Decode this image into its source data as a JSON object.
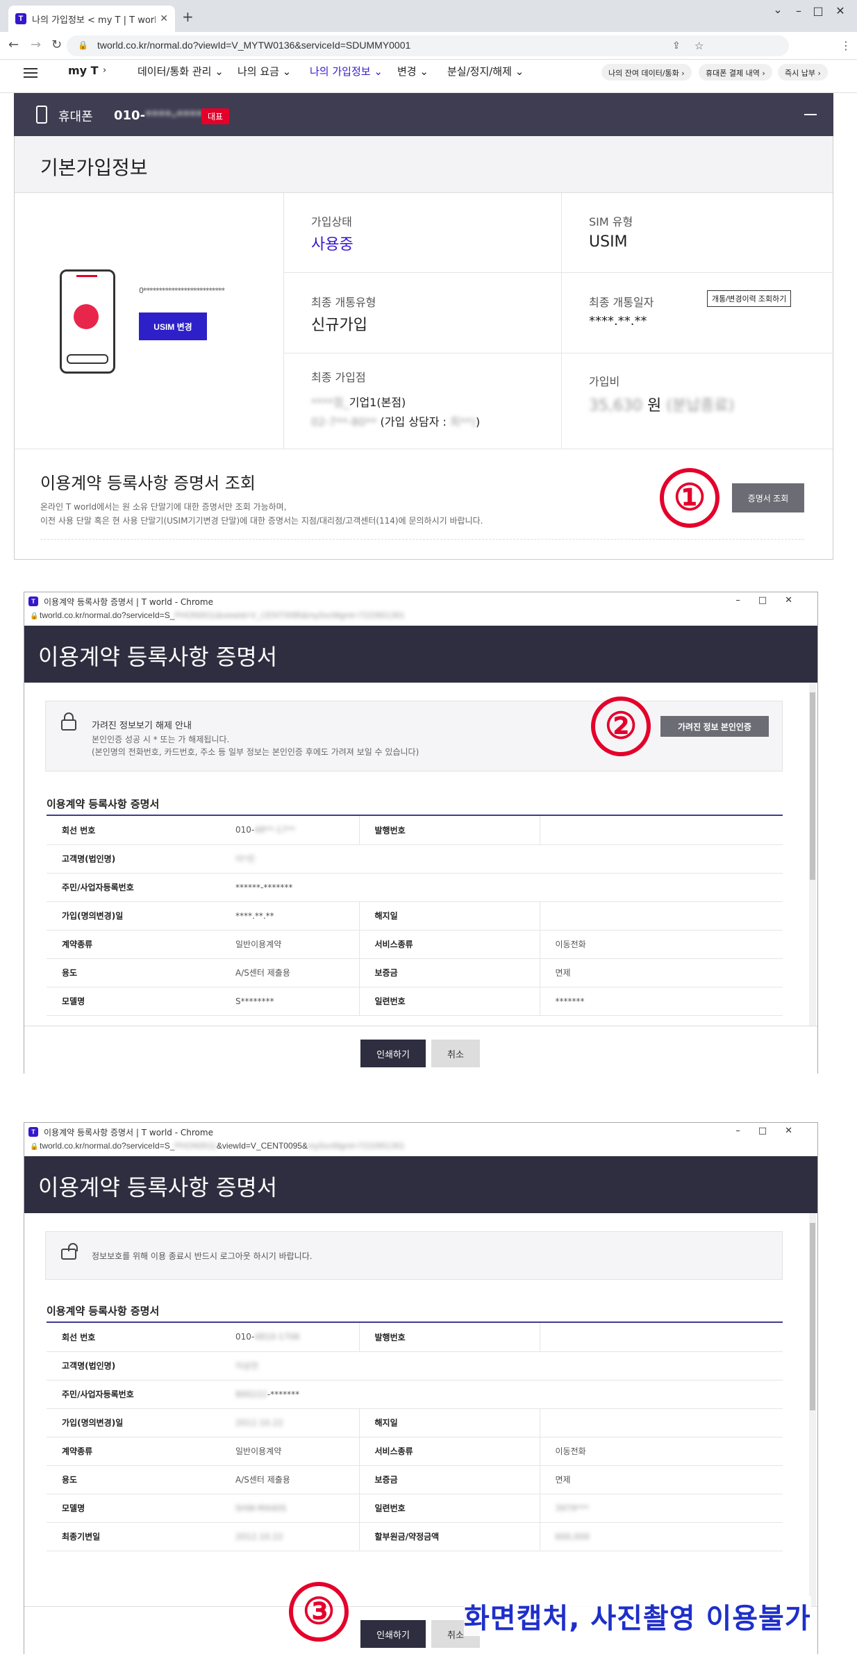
{
  "browser": {
    "tab_title": "나의 가입정보 < my T | T world",
    "url": "tworld.co.kr/normal.do?viewId=V_MYTW0136&serviceId=SDUMMY0001",
    "logo_letter": "T"
  },
  "site_nav": {
    "brand": "my T",
    "items": [
      "데이터/통화 관리",
      "나의 요금",
      "나의 가입정보",
      "변경",
      "분실/정지/해제"
    ],
    "active_index": 2,
    "pills": [
      "나의 잔여 데이터/통화",
      "휴대폰 결제 내역",
      "즉시 납부"
    ]
  },
  "phone_bar": {
    "label": "휴대폰",
    "number": "010-",
    "number_masked": "****-****",
    "badge": "대표"
  },
  "basic_info": {
    "title": "기본가입정보",
    "sim_number": "0**************************",
    "usim_button": "USIM 변경",
    "fields": {
      "status_label": "가입상태",
      "status_value": "사용중",
      "sim_label": "SIM 유형",
      "sim_value": "USIM",
      "open_type_label": "최종 개통유형",
      "open_type_value": "신규가입",
      "open_date_label": "최종 개통일자",
      "open_date_value": "****.**.**",
      "history_button": "개통/변경이력 조회하기",
      "store_label": "최종 가입점",
      "store_line1": "기업1(본점)",
      "store_line2": "(가입 상담자 :",
      "fee_label": "가입비",
      "fee_value": "원"
    }
  },
  "cert_section": {
    "title": "이용계약 등록사항 증명서 조회",
    "desc1": "온라인 T world에서는 원 소유 단말기에 대한 증명서만 조회 가능하며,",
    "desc2": "이전 사용 단말 혹은 현 사용 단말기(USIM기기변경 단말)에 대한 증명서는 지점/대리점/고객센터(114)에 문의하시기 바랍니다.",
    "button": "증명서 조회"
  },
  "step_markers": [
    "①",
    "②",
    "③"
  ],
  "popup1": {
    "window_title": "이용계약 등록사항 증명서 | T world - Chrome",
    "url": "tworld.co.kr/normal.do?serviceId=S_",
    "heading": "이용계약 등록사항 증명서",
    "notice_title": "가려진 정보보기 해제 안내",
    "notice_line1": "본인인증 성공 시 * 또는 가 해제됩니다.",
    "notice_line2": "(본인명의 전화번호, 카드번호, 주소 등 일부 정보는 본인인증 후에도 가려져 보일 수 있습니다)",
    "auth_button": "가려진 정보 본인인증",
    "table_title": "이용계약 등록사항 증명서",
    "rows": [
      {
        "h1": "회선 번호",
        "v1": "010-",
        "h2": "발행번호",
        "v2": ""
      },
      {
        "h1": "고객명(법인명)",
        "v1": "",
        "h2": "",
        "v2": ""
      },
      {
        "h1": "주민/사업자등록번호",
        "v1": "******-*******",
        "h2": "",
        "v2": ""
      },
      {
        "h1": "가입(명의변경)일",
        "v1": "****.**.**",
        "h2": "해지일",
        "v2": ""
      },
      {
        "h1": "계약종류",
        "v1": "일반이용계약",
        "h2": "서비스종류",
        "v2": "이동전화"
      },
      {
        "h1": "용도",
        "v1": "A/S센터 제출용",
        "h2": "보증금",
        "v2": "면제"
      },
      {
        "h1": "모델명",
        "v1": "S********",
        "h2": "일련번호",
        "v2": "*******"
      }
    ],
    "print_button": "인쇄하기",
    "cancel_button": "취소"
  },
  "popup2": {
    "window_title": "이용계약 등록사항 증명서 | T world - Chrome",
    "url": "tworld.co.kr/normal.do?serviceId=S_",
    "url_tail": "&viewId=V_CENT0095&",
    "heading": "이용계약 등록사항 증명서",
    "notice_title": "정보보호를 위해 이용 종료시 반드시 로그아웃 하시기 바랍니다.",
    "table_title": "이용계약 등록사항 증명서",
    "rows": [
      {
        "h1": "회선 번호",
        "v1": "010-",
        "h2": "발행번호",
        "v2": ""
      },
      {
        "h1": "고객명(법인명)",
        "v1": "",
        "h2": "",
        "v2": ""
      },
      {
        "h1": "주민/사업자등록번호",
        "v1": "-*******",
        "h2": "",
        "v2": ""
      },
      {
        "h1": "가입(명의변경)일",
        "v1": "",
        "h2": "해지일",
        "v2": ""
      },
      {
        "h1": "계약종류",
        "v1": "일반이용계약",
        "h2": "서비스종류",
        "v2": "이동전화"
      },
      {
        "h1": "용도",
        "v1": "A/S센터 제출용",
        "h2": "보증금",
        "v2": "면제"
      },
      {
        "h1": "모델명",
        "v1": "",
        "h2": "일련번호",
        "v2": ""
      },
      {
        "h1": "최종기변일",
        "v1": "",
        "h2": "할부원금/약정금액",
        "v2": ""
      }
    ],
    "print_button": "인쇄하기",
    "cancel_button": "취소"
  },
  "warning_text": "화면캡처, 사진촬영 이용불가",
  "colors": {
    "brand": "#3617ce",
    "red": "#e4002b",
    "dark": "#2f2e40"
  }
}
